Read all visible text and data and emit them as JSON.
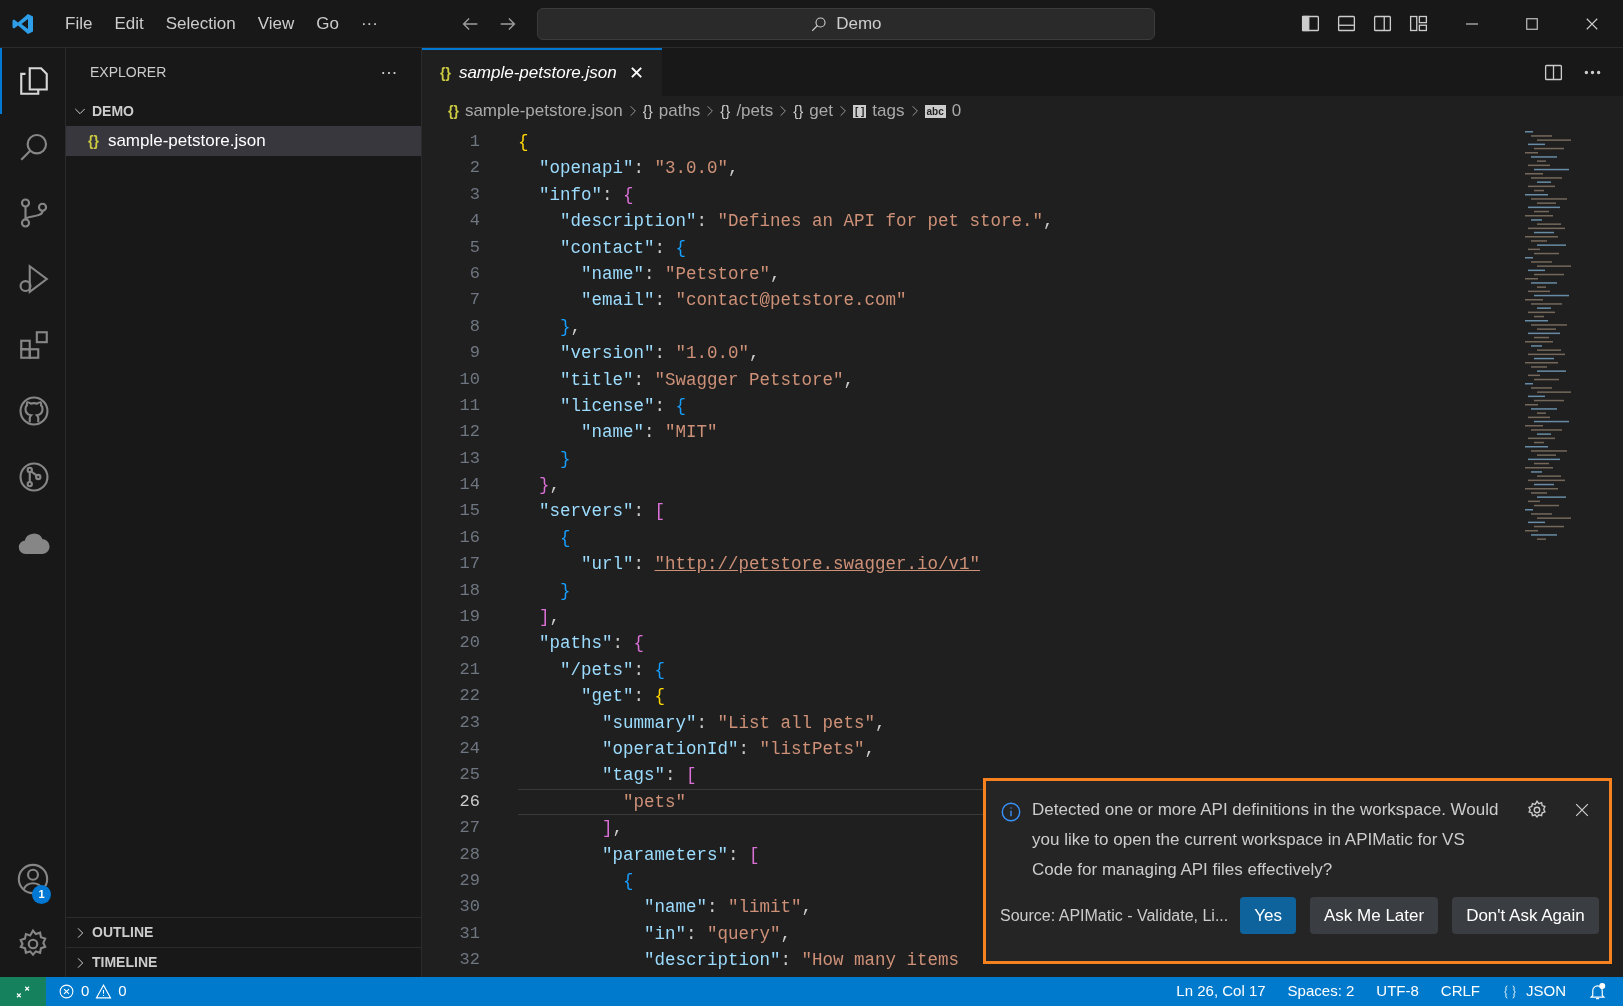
{
  "title_bar": {
    "menus": [
      "File",
      "Edit",
      "Selection",
      "View",
      "Go",
      "···"
    ],
    "search": "Demo"
  },
  "activity_bar": {
    "items": [
      {
        "kind": "files",
        "selected": true
      },
      {
        "kind": "search",
        "selected": false
      },
      {
        "kind": "source-control",
        "selected": false
      },
      {
        "kind": "run",
        "selected": false
      },
      {
        "kind": "extensions",
        "selected": false
      },
      {
        "kind": "github",
        "selected": false
      },
      {
        "kind": "graph",
        "selected": false
      },
      {
        "kind": "cloud",
        "selected": false
      }
    ],
    "account_badge": "1"
  },
  "sidebar": {
    "title": "EXPLORER",
    "more": "···",
    "folder": {
      "label": "DEMO",
      "expanded": true,
      "files": [
        {
          "icon": "{}",
          "label": "sample-petstore.json",
          "selected": true
        }
      ]
    },
    "sections": [
      {
        "label": "OUTLINE",
        "expanded": false
      },
      {
        "label": "TIMELINE",
        "expanded": false
      }
    ]
  },
  "tabs": [
    {
      "icon": "{}",
      "label": "sample-petstore.json",
      "selected": true,
      "preview": true,
      "close": "✕"
    }
  ],
  "breadcrumb": [
    {
      "icon": "{}",
      "label": "sample-petstore.json"
    },
    {
      "icon": "{}",
      "label": "paths"
    },
    {
      "icon": "{}",
      "label": "/pets"
    },
    {
      "icon": "{}",
      "label": "get"
    },
    {
      "icon": "[ ]",
      "label": "tags"
    },
    {
      "icon": "abc",
      "label": "0"
    }
  ],
  "code_lines": [
    {
      "number": "1",
      "selected": false,
      "tokens": [
        {
          "kind": "b1",
          "text": "{"
        }
      ]
    },
    {
      "number": "2",
      "selected": false,
      "tokens": [
        {
          "kind": "key",
          "text": "  \"openapi\""
        },
        {
          "kind": "punc",
          "text": ": "
        },
        {
          "kind": "str",
          "text": "\"3.0.0\""
        },
        {
          "kind": "punc",
          "text": ","
        }
      ]
    },
    {
      "number": "3",
      "selected": false,
      "tokens": [
        {
          "kind": "key",
          "text": "  \"info\""
        },
        {
          "kind": "punc",
          "text": ": "
        },
        {
          "kind": "b2",
          "text": "{"
        }
      ]
    },
    {
      "number": "4",
      "selected": false,
      "tokens": [
        {
          "kind": "key",
          "text": "    \"description\""
        },
        {
          "kind": "punc",
          "text": ": "
        },
        {
          "kind": "str",
          "text": "\"Defines an API for pet store.\""
        },
        {
          "kind": "punc",
          "text": ","
        }
      ]
    },
    {
      "number": "5",
      "selected": false,
      "tokens": [
        {
          "kind": "key",
          "text": "    \"contact\""
        },
        {
          "kind": "punc",
          "text": ": "
        },
        {
          "kind": "b3",
          "text": "{"
        }
      ]
    },
    {
      "number": "6",
      "selected": false,
      "tokens": [
        {
          "kind": "key",
          "text": "      \"name\""
        },
        {
          "kind": "punc",
          "text": ": "
        },
        {
          "kind": "str",
          "text": "\"Petstore\""
        },
        {
          "kind": "punc",
          "text": ","
        }
      ]
    },
    {
      "number": "7",
      "selected": false,
      "tokens": [
        {
          "kind": "key",
          "text": "      \"email\""
        },
        {
          "kind": "punc",
          "text": ": "
        },
        {
          "kind": "str",
          "text": "\"contact@petstore.com\""
        }
      ]
    },
    {
      "number": "8",
      "selected": false,
      "tokens": [
        {
          "kind": "b3",
          "text": "    }"
        },
        {
          "kind": "punc",
          "text": ","
        }
      ]
    },
    {
      "number": "9",
      "selected": false,
      "tokens": [
        {
          "kind": "key",
          "text": "    \"version\""
        },
        {
          "kind": "punc",
          "text": ": "
        },
        {
          "kind": "str",
          "text": "\"1.0.0\""
        },
        {
          "kind": "punc",
          "text": ","
        }
      ]
    },
    {
      "number": "10",
      "selected": false,
      "tokens": [
        {
          "kind": "key",
          "text": "    \"title\""
        },
        {
          "kind": "punc",
          "text": ": "
        },
        {
          "kind": "str",
          "text": "\"Swagger Petstore\""
        },
        {
          "kind": "punc",
          "text": ","
        }
      ]
    },
    {
      "number": "11",
      "selected": false,
      "tokens": [
        {
          "kind": "key",
          "text": "    \"license\""
        },
        {
          "kind": "punc",
          "text": ": "
        },
        {
          "kind": "b3",
          "text": "{"
        }
      ]
    },
    {
      "number": "12",
      "selected": false,
      "tokens": [
        {
          "kind": "key",
          "text": "      \"name\""
        },
        {
          "kind": "punc",
          "text": ": "
        },
        {
          "kind": "str",
          "text": "\"MIT\""
        }
      ]
    },
    {
      "number": "13",
      "selected": false,
      "tokens": [
        {
          "kind": "b3",
          "text": "    }"
        }
      ]
    },
    {
      "number": "14",
      "selected": false,
      "tokens": [
        {
          "kind": "b2",
          "text": "  }"
        },
        {
          "kind": "punc",
          "text": ","
        }
      ]
    },
    {
      "number": "15",
      "selected": false,
      "tokens": [
        {
          "kind": "key",
          "text": "  \"servers\""
        },
        {
          "kind": "punc",
          "text": ": "
        },
        {
          "kind": "b2",
          "text": "["
        }
      ]
    },
    {
      "number": "16",
      "selected": false,
      "tokens": [
        {
          "kind": "b3",
          "text": "    {"
        }
      ]
    },
    {
      "number": "17",
      "selected": false,
      "tokens": [
        {
          "kind": "key",
          "text": "      \"url\""
        },
        {
          "kind": "punc",
          "text": ": "
        },
        {
          "kind": "link",
          "text": "\"http://petstore.swagger.io/v1\""
        }
      ]
    },
    {
      "number": "18",
      "selected": false,
      "tokens": [
        {
          "kind": "b3",
          "text": "    }"
        }
      ]
    },
    {
      "number": "19",
      "selected": false,
      "tokens": [
        {
          "kind": "b2",
          "text": "  ]"
        },
        {
          "kind": "punc",
          "text": ","
        }
      ]
    },
    {
      "number": "20",
      "selected": false,
      "tokens": [
        {
          "kind": "key",
          "text": "  \"paths\""
        },
        {
          "kind": "punc",
          "text": ": "
        },
        {
          "kind": "b2",
          "text": "{"
        }
      ]
    },
    {
      "number": "21",
      "selected": false,
      "tokens": [
        {
          "kind": "key",
          "text": "    \"/pets\""
        },
        {
          "kind": "punc",
          "text": ": "
        },
        {
          "kind": "b3",
          "text": "{"
        }
      ]
    },
    {
      "number": "22",
      "selected": false,
      "tokens": [
        {
          "kind": "key",
          "text": "      \"get\""
        },
        {
          "kind": "punc",
          "text": ": "
        },
        {
          "kind": "b1",
          "text": "{"
        }
      ]
    },
    {
      "number": "23",
      "selected": false,
      "tokens": [
        {
          "kind": "key",
          "text": "        \"summary\""
        },
        {
          "kind": "punc",
          "text": ": "
        },
        {
          "kind": "str",
          "text": "\"List all pets\""
        },
        {
          "kind": "punc",
          "text": ","
        }
      ]
    },
    {
      "number": "24",
      "selected": false,
      "tokens": [
        {
          "kind": "key",
          "text": "        \"operationId\""
        },
        {
          "kind": "punc",
          "text": ": "
        },
        {
          "kind": "str",
          "text": "\"listPets\""
        },
        {
          "kind": "punc",
          "text": ","
        }
      ]
    },
    {
      "number": "25",
      "selected": false,
      "tokens": [
        {
          "kind": "key",
          "text": "        \"tags\""
        },
        {
          "kind": "punc",
          "text": ": "
        },
        {
          "kind": "b2",
          "text": "["
        }
      ]
    },
    {
      "number": "26",
      "selected": true,
      "tokens": [
        {
          "kind": "str",
          "text": "          \"pets\""
        }
      ]
    },
    {
      "number": "27",
      "selected": false,
      "tokens": [
        {
          "kind": "b2",
          "text": "        ]"
        },
        {
          "kind": "punc",
          "text": ","
        }
      ]
    },
    {
      "number": "28",
      "selected": false,
      "tokens": [
        {
          "kind": "key",
          "text": "        \"parameters\""
        },
        {
          "kind": "punc",
          "text": ": "
        },
        {
          "kind": "b2",
          "text": "["
        }
      ]
    },
    {
      "number": "29",
      "selected": false,
      "tokens": [
        {
          "kind": "b3",
          "text": "          {"
        }
      ]
    },
    {
      "number": "30",
      "selected": false,
      "tokens": [
        {
          "kind": "key",
          "text": "            \"name\""
        },
        {
          "kind": "punc",
          "text": ": "
        },
        {
          "kind": "str",
          "text": "\"limit\""
        },
        {
          "kind": "punc",
          "text": ","
        }
      ]
    },
    {
      "number": "31",
      "selected": false,
      "tokens": [
        {
          "kind": "key",
          "text": "            \"in\""
        },
        {
          "kind": "punc",
          "text": ": "
        },
        {
          "kind": "str",
          "text": "\"query\""
        },
        {
          "kind": "punc",
          "text": ","
        }
      ]
    },
    {
      "number": "32",
      "selected": false,
      "tokens": [
        {
          "kind": "key",
          "text": "            \"description\""
        },
        {
          "kind": "punc",
          "text": ": "
        },
        {
          "kind": "str",
          "text": "\"How many items"
        }
      ]
    }
  ],
  "notification": {
    "message": "Detected one or more API definitions in the workspace. Would you like to open the current workspace in APIMatic for VS Code for managing API files effectively?",
    "source": "Source: APIMatic - Validate, Li...",
    "buttons": [
      {
        "label": "Yes",
        "kind": "primary"
      },
      {
        "label": "Ask Me Later",
        "kind": "secondary"
      },
      {
        "label": "Don't Ask Again",
        "kind": "secondary"
      }
    ]
  },
  "status_bar": {
    "errors": "0",
    "warnings": "0",
    "items": [
      "Ln 26, Col 17",
      "Spaces: 2",
      "UTF-8",
      "CRLF",
      "JSON"
    ]
  }
}
